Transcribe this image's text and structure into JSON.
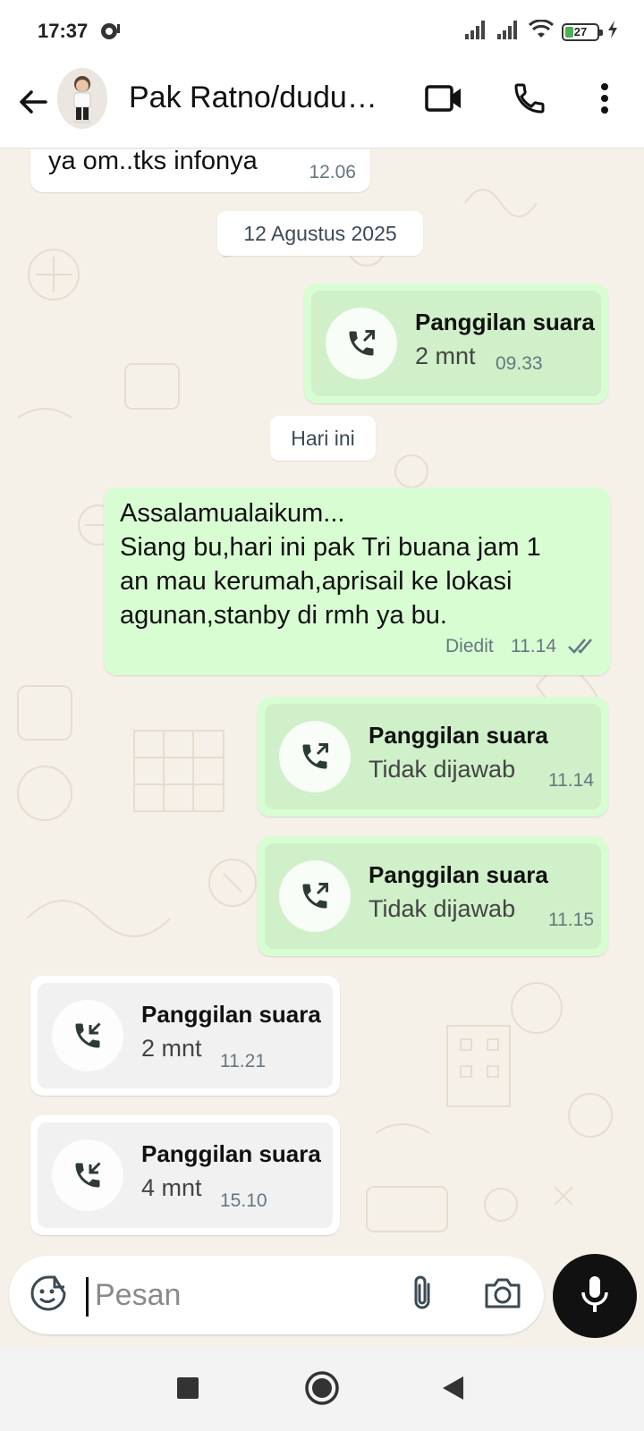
{
  "status_bar": {
    "time": "17:37",
    "battery_level": "27",
    "battery_fraction": 0.27,
    "icons": [
      "notification-icon",
      "signal-icon",
      "signal-icon",
      "wifi-icon",
      "battery-icon",
      "charging-icon"
    ]
  },
  "header": {
    "contact_name": "Pak Ratno/dudun...",
    "icons": [
      "back-arrow-icon",
      "video-call-icon",
      "phone-icon",
      "more-vert-icon"
    ]
  },
  "messages": {
    "m0": {
      "text": "ya om..tks infonya",
      "time": "12.06",
      "direction": "incoming"
    },
    "date1": "12 Agustus 2025",
    "c1": {
      "title": "Panggilan suara",
      "detail": "2 mnt",
      "time": "09.33",
      "direction": "outgoing"
    },
    "date2": "Hari ini",
    "m1": {
      "line1": "Assalamualaikum...",
      "line2": "Siang bu,hari ini pak Tri buana jam 1",
      "line3": "an mau kerumah,aprisail ke lokasi",
      "line4": "agunan,stanby di rmh ya bu.",
      "edited": "Diedit",
      "time": "11.14",
      "status": "read"
    },
    "c2": {
      "title": "Panggilan suara",
      "detail": "Tidak dijawab",
      "time": "11.14",
      "direction": "outgoing"
    },
    "c3": {
      "title": "Panggilan suara",
      "detail": "Tidak dijawab",
      "time": "11.15",
      "direction": "outgoing"
    },
    "c4": {
      "title": "Panggilan suara",
      "detail": "2 mnt",
      "time": "11.21",
      "direction": "incoming"
    },
    "c5": {
      "title": "Panggilan suara",
      "detail": "4 mnt",
      "time": "15.10",
      "direction": "incoming"
    }
  },
  "input": {
    "placeholder": "Pesan",
    "value": "",
    "icons": [
      "sticker-icon",
      "attach-icon",
      "camera-icon",
      "mic-icon"
    ]
  },
  "colors": {
    "outgoing_bubble": "#d9fdd3",
    "incoming_bubble": "#ffffff",
    "wallpaper": "#f5f1e9",
    "read_ticks": "#667781"
  }
}
